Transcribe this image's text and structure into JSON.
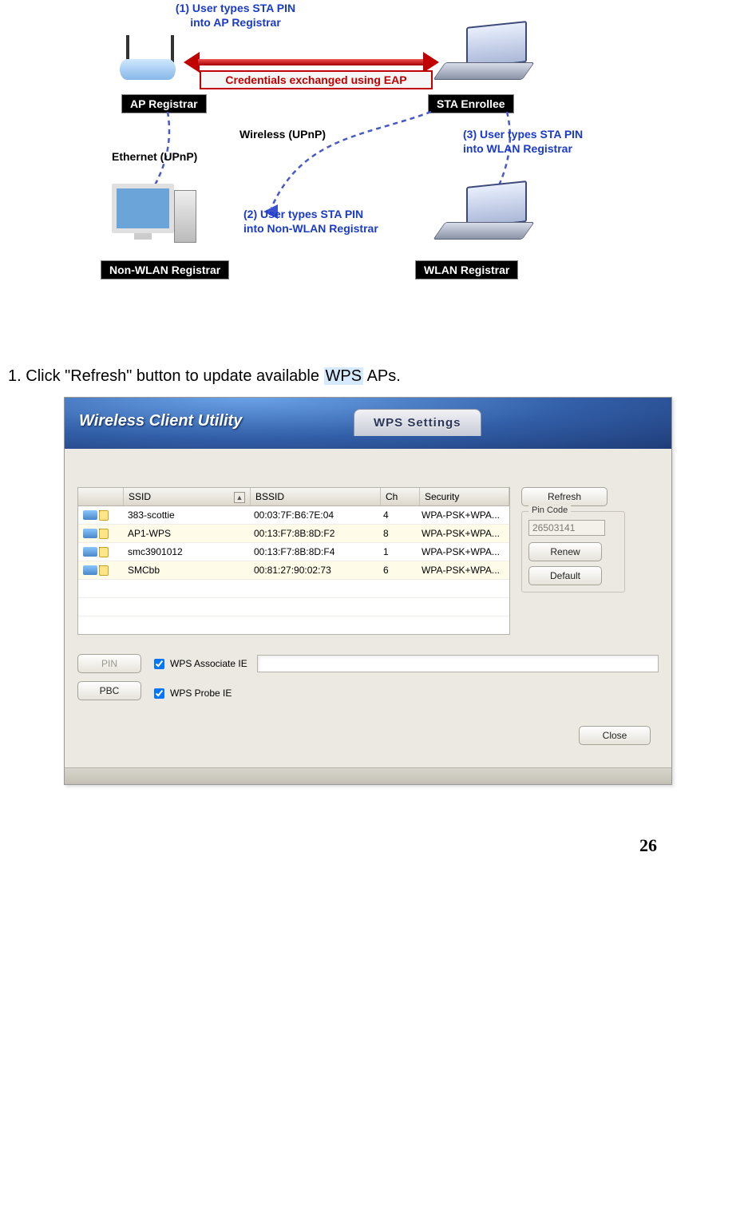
{
  "diagram": {
    "step1": "(1) User types STA PIN\ninto AP Registrar",
    "eap_caption": "Credentials exchanged using EAP",
    "ap_registrar": "AP Registrar",
    "sta_enrollee": "STA Enrollee",
    "wireless_upnp": "Wireless (UPnP)",
    "ethernet_upnp": "Ethernet (UPnP)",
    "step3": "(3) User types STA PIN\ninto WLAN Registrar",
    "step2": "(2) User types STA PIN\ninto Non-WLAN Registrar",
    "non_wlan_reg": "Non-WLAN Registrar",
    "wlan_reg": "WLAN Registrar"
  },
  "instruction": {
    "number": "1.",
    "pre": " Click \"Refresh\" button to update available ",
    "hl": "WPS",
    "post": " APs."
  },
  "utility": {
    "title": "Wireless Client Utility",
    "tab": "WPS Settings",
    "headers": {
      "ssid": "SSID",
      "bssid": "BSSID",
      "ch": "Ch",
      "security": "Security"
    },
    "rows": [
      {
        "ssid": "383-scottie",
        "bssid": "00:03:7F:B6:7E:04",
        "ch": "4",
        "sec": "WPA-PSK+WPA..."
      },
      {
        "ssid": "AP1-WPS",
        "bssid": "00:13:F7:8B:8D:F2",
        "ch": "8",
        "sec": "WPA-PSK+WPA..."
      },
      {
        "ssid": "smc3901012",
        "bssid": "00:13:F7:8B:8D:F4",
        "ch": "1",
        "sec": "WPA-PSK+WPA..."
      },
      {
        "ssid": "SMCbb",
        "bssid": "00:81:27:90:02:73",
        "ch": "6",
        "sec": "WPA-PSK+WPA..."
      }
    ],
    "buttons": {
      "refresh": "Refresh",
      "renew": "Renew",
      "default": "Default",
      "pin": "PIN",
      "pbc": "PBC",
      "close": "Close"
    },
    "pin": {
      "legend": "Pin Code",
      "value": "26503141"
    },
    "checks": {
      "assoc": "WPS Associate IE",
      "probe": "WPS Probe IE"
    }
  },
  "page_number": "26"
}
